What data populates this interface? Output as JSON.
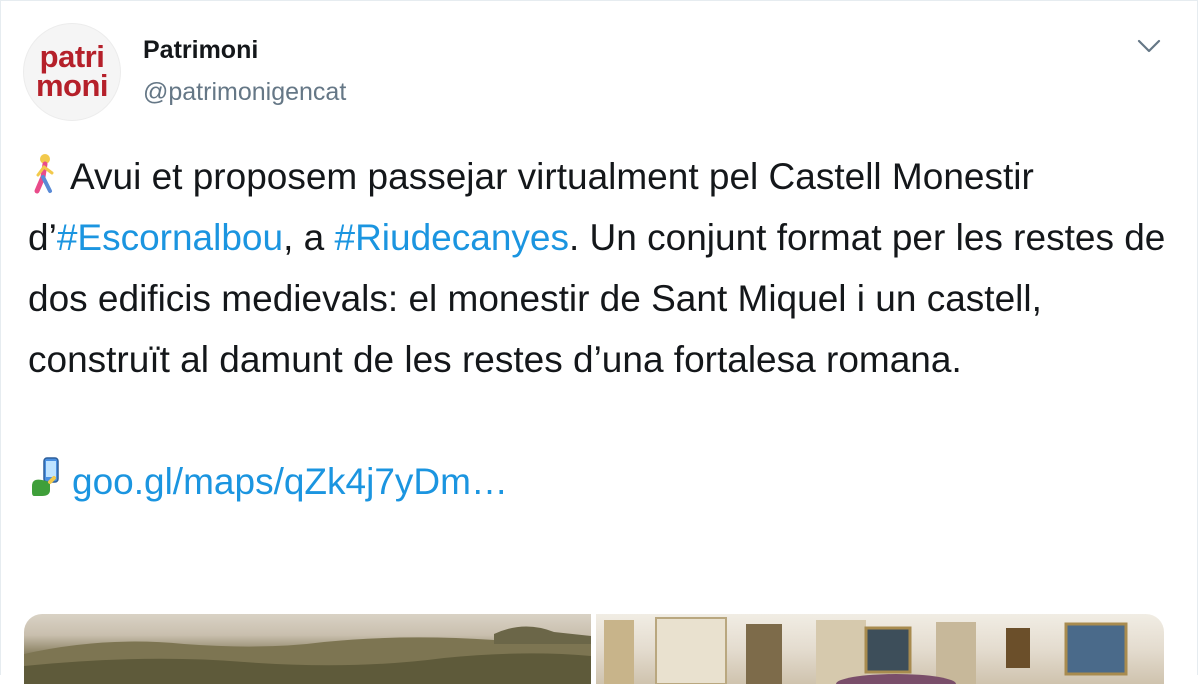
{
  "author": {
    "display_name": "Patrimoni",
    "handle": "@patrimonigencat",
    "avatar_text_line1": "patri",
    "avatar_text_line2": "moni"
  },
  "tweet": {
    "emoji_walking": "walking-person-emoji",
    "text_part1": "Avui et proposem passejar virtualment pel Castell Monestir d’",
    "hashtag1": "#Escornalbou",
    "text_part2": ", a ",
    "hashtag2": "#Riudecanyes",
    "text_part3": ". Un conjunt format per les restes de dos edificis medievals: el monestir de Sant Miquel i un castell, construït al damunt de les restes d’una fortalesa romana.",
    "emoji_phone": "pointing-phone-emoji",
    "link_text": "goo.gl/maps/qZk4j7yDm…"
  },
  "media": {
    "images": [
      "castle-landscape-photo",
      "castle-interior-photo"
    ]
  },
  "colors": {
    "link": "#1b95e0",
    "secondary_text": "#657786",
    "brand_red": "#b5202a"
  }
}
